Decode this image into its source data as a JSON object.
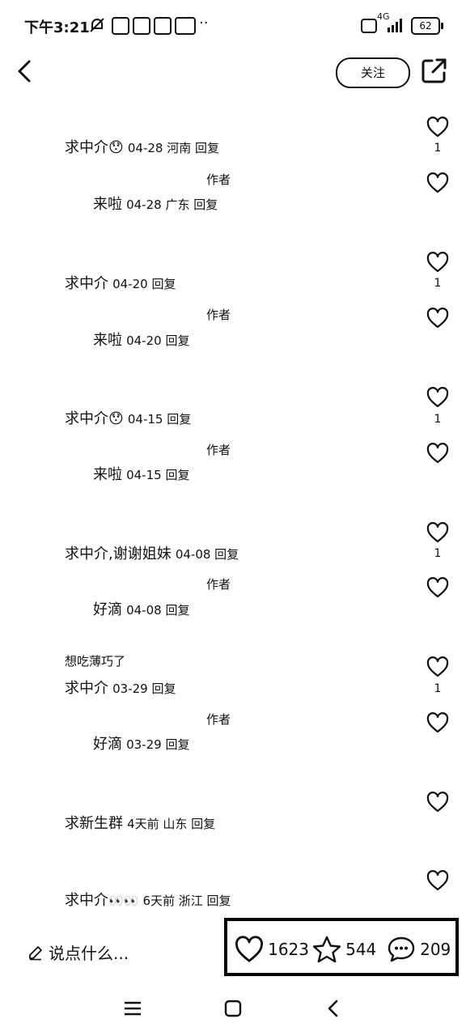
{
  "status": {
    "time": "下午3:21",
    "battery": "62",
    "network": "4G"
  },
  "header": {
    "follow_label": "关注"
  },
  "comments": [
    {
      "text": "求中介",
      "emoji": "😯",
      "meta": "04-28 河南 回复",
      "likes": "1",
      "author_label": "作者",
      "reply_text": "来啦",
      "reply_meta": "04-28 广东 回复"
    },
    {
      "text": "求中介",
      "meta": "04-20  回复",
      "likes": "1",
      "author_label": "作者",
      "reply_text": "来啦",
      "reply_meta": "04-20  回复"
    },
    {
      "text": "求中介",
      "emoji": "😯",
      "meta": "04-15  回复",
      "likes": "1",
      "author_label": "作者",
      "reply_text": "来啦",
      "reply_meta": "04-15  回复"
    },
    {
      "text": "求中介,谢谢姐妹",
      "meta": "04-08  回复",
      "likes": "1",
      "author_label": "作者",
      "reply_text": "好滴",
      "reply_meta": "04-08  回复"
    },
    {
      "pre_text": "想吃薄巧了",
      "text": "求中介",
      "meta": "03-29  回复",
      "likes": "1",
      "author_label": "作者",
      "reply_text": "好滴",
      "reply_meta": "03-29  回复"
    },
    {
      "text": "求新生群",
      "meta": "4天前  山东 回复"
    },
    {
      "text": "求中介",
      "emoji": "👀👀",
      "meta": "6天前  浙江 回复"
    }
  ],
  "footer": {
    "placeholder": "说点什么...",
    "likes": "1623",
    "stars": "544",
    "comments": "209"
  },
  "icons": {
    "back": "chevron-left-icon",
    "share": "share-icon",
    "like": "heart-icon",
    "star": "star-icon",
    "comment": "comment-bubble-icon",
    "edit": "pencil-icon"
  }
}
